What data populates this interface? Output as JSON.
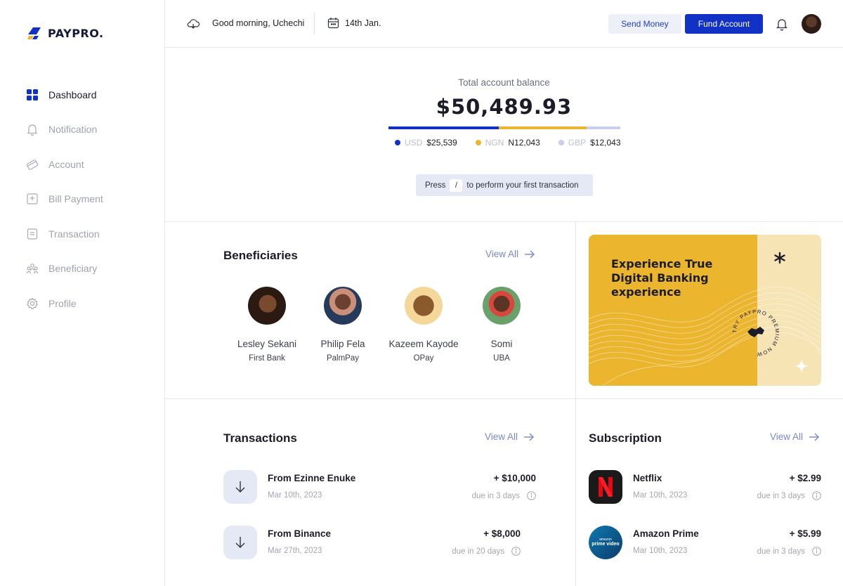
{
  "app": {
    "brand": "PAYPRO."
  },
  "sidebar": {
    "items": [
      {
        "label": "Dashboard",
        "icon": "grid-icon",
        "active": true
      },
      {
        "label": "Notification",
        "icon": "bell-icon"
      },
      {
        "label": "Account",
        "icon": "card-icon"
      },
      {
        "label": "Bill Payment",
        "icon": "bill-icon"
      },
      {
        "label": "Transaction",
        "icon": "receipt-icon"
      },
      {
        "label": "Beneficiary",
        "icon": "users-icon"
      },
      {
        "label": "Profile",
        "icon": "gear-icon"
      }
    ]
  },
  "header": {
    "greeting": "Good morning, Uchechi",
    "date": "14th Jan.",
    "send_money": "Send Money",
    "fund_account": "Fund Account"
  },
  "balance": {
    "label": "Total account balance",
    "amount": "$50,489.93",
    "breakdown": [
      {
        "currency": "USD",
        "amount": "$25,539",
        "color": "#1232c6",
        "share": 0.475
      },
      {
        "currency": "NGN",
        "amount": "N12,043",
        "color": "#ecb52e",
        "share": 0.38
      },
      {
        "currency": "GBP",
        "amount": "$12,043",
        "color": "#c9cdf0",
        "share": 0.145
      }
    ],
    "hint_before": "Press",
    "hint_key": "/",
    "hint_after": "to perform your first transaction"
  },
  "beneficiaries": {
    "title": "Beneficiaries",
    "view_all": "View All",
    "people": [
      {
        "name": "Lesley Sekani",
        "bank": "First Bank"
      },
      {
        "name": "Philip Fela",
        "bank": "PalmPay"
      },
      {
        "name": "Kazeem Kayode",
        "bank": "OPay"
      },
      {
        "name": "Somi",
        "bank": "UBA"
      }
    ]
  },
  "promo": {
    "line1": "Experience True",
    "line2": "Digital Banking",
    "line3": "experience",
    "badge": "TRY PAYPRO PREMIUM NOW"
  },
  "transactions": {
    "title": "Transactions",
    "view_all": "View All",
    "items": [
      {
        "title": "From Ezinne Enuke",
        "date": "Mar 10th, 2023",
        "amount": "+ $10,000",
        "due": "due in 3 days"
      },
      {
        "title": "From Binance",
        "date": "Mar 27th, 2023",
        "amount": "+ $8,000",
        "due": "due in 20 days"
      }
    ]
  },
  "subscription": {
    "title": "Subscription",
    "view_all": "View All",
    "items": [
      {
        "title": "Netflix",
        "date": "Mar 10th, 2023",
        "amount": "+ $2.99",
        "due": "due in 3 days"
      },
      {
        "title": "Amazon Prime",
        "date": "Mar 10th, 2023",
        "amount": "+ $5.99",
        "due": "due in 3 days",
        "logo_text_top": "amazon",
        "logo_text_bottom": "prime video"
      }
    ]
  }
}
